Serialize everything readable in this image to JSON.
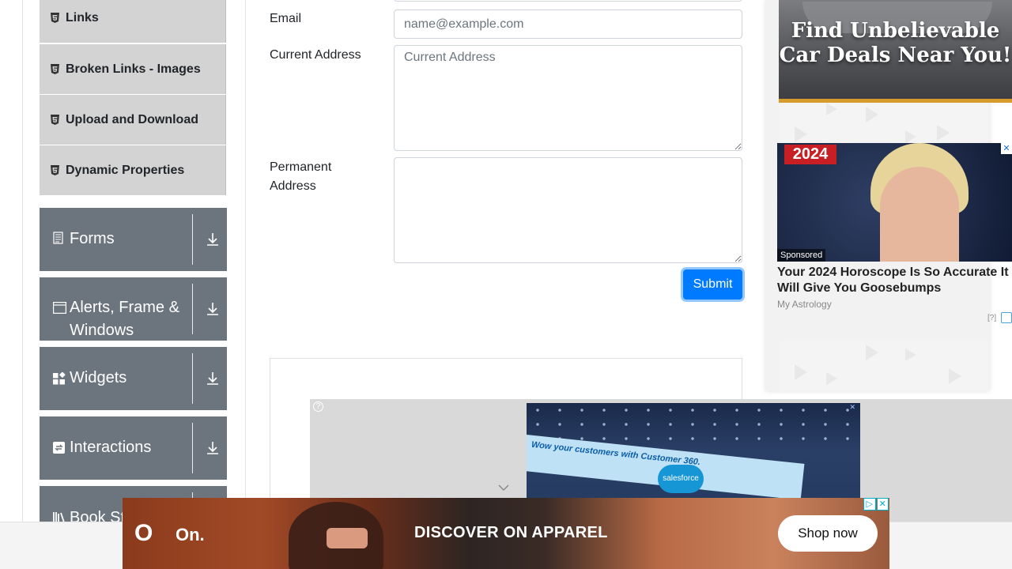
{
  "sidebar": {
    "elements_items": [
      {
        "label": "Links",
        "icon": "html5-icon"
      },
      {
        "label": "Broken Links - Images",
        "icon": "html5-icon"
      },
      {
        "label": "Upload and Download",
        "icon": "html5-icon"
      },
      {
        "label": "Dynamic Properties",
        "icon": "html5-icon"
      }
    ],
    "groups": [
      {
        "label": "Forms",
        "icon": "form-icon"
      },
      {
        "label": "Alerts, Frame & Windows",
        "icon": "window-icon"
      },
      {
        "label": "Widgets",
        "icon": "widgets-icon"
      },
      {
        "label": "Interactions",
        "icon": "interactions-icon"
      },
      {
        "label": "Book Store Application",
        "visible_label": "Book St",
        "icon": "bookstore-icon"
      }
    ]
  },
  "form": {
    "email_label": "Email",
    "email_placeholder": "name@example.com",
    "current_address_label": "Current Address",
    "current_address_placeholder": "Current Address",
    "permanent_address_label": "Permanent Address",
    "submit_label": "Submit"
  },
  "ads": {
    "car_headline": "Find Unbelievable Car Deals Near You!",
    "horoscope_year": "2024",
    "sponsored": "Sponsored",
    "horoscope_title": "Your 2024 Horoscope Is So Accurate It Will Give You Goosebumps",
    "horoscope_brand": "My Astrology",
    "horoscope_q": "[?]",
    "video_banner_text": "Wow your customers with Customer 360.",
    "video_logo": "salesforce",
    "banner_logo_mark": "O",
    "banner_logo_text": "On.",
    "banner_headline": "DISCOVER ON APPAREL",
    "banner_cta": "Shop now",
    "accent_blue": "#007bff",
    "sidebar_gray": "#6c757d"
  }
}
